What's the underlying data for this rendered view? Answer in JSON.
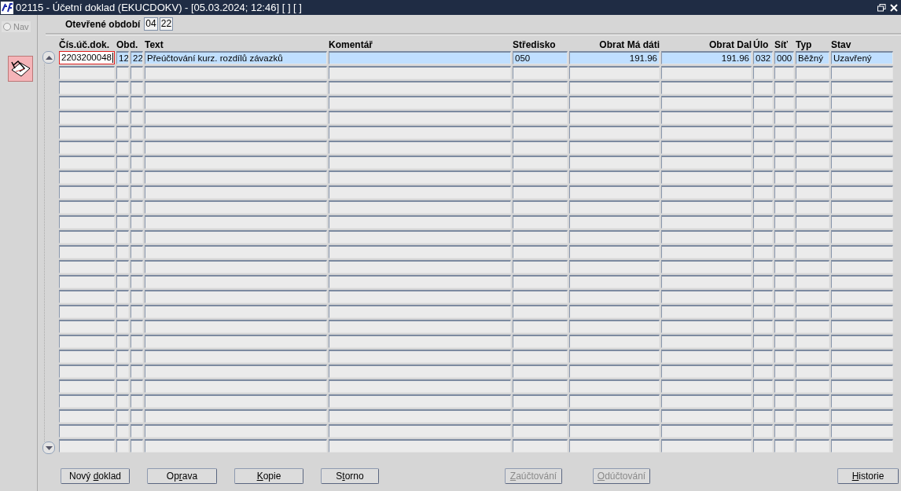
{
  "window": {
    "title": "02115 - Účetní doklad (EKUCDOKV) - [05.03.2024; 12:46] [ ] [ ]"
  },
  "sidebar": {
    "nav": {
      "label": "Nav",
      "selected": false
    }
  },
  "period": {
    "label": "Otevřené období",
    "values": [
      "04",
      "22"
    ]
  },
  "table": {
    "columns": [
      {
        "label": "Čís.úč.dok."
      },
      {
        "label": "Obd."
      },
      {},
      {
        "label": "Text"
      },
      {
        "label": "Komentář"
      },
      {
        "label": "Středisko"
      },
      {
        "label": "Obrat Má dáti"
      },
      {
        "label": "Obrat Dal"
      },
      {
        "label": "Úlo"
      },
      {
        "label": "Síť"
      },
      {
        "label": "Typ"
      },
      {
        "label": "Stav"
      }
    ],
    "rows": [
      {
        "selected": true,
        "focused": true,
        "cells": [
          "2203200048",
          "12",
          "22",
          "Přeúčtování kurz. rozdílů závazků",
          "",
          "050",
          "191.96",
          "191.96",
          "032",
          "000",
          "Běžný",
          "Uzavřený"
        ]
      }
    ]
  },
  "buttons": [
    {
      "label": "Nový doklad",
      "disabled": false
    },
    {
      "label": "Oprava",
      "disabled": false
    },
    {
      "label": "Kopie",
      "disabled": false
    },
    {
      "label": "Storno",
      "disabled": false
    },
    {
      "label": "Zaúčtování",
      "disabled": true
    },
    {
      "label": "Odúčtování",
      "disabled": true
    },
    {
      "label": "Historie",
      "disabled": false
    }
  ]
}
